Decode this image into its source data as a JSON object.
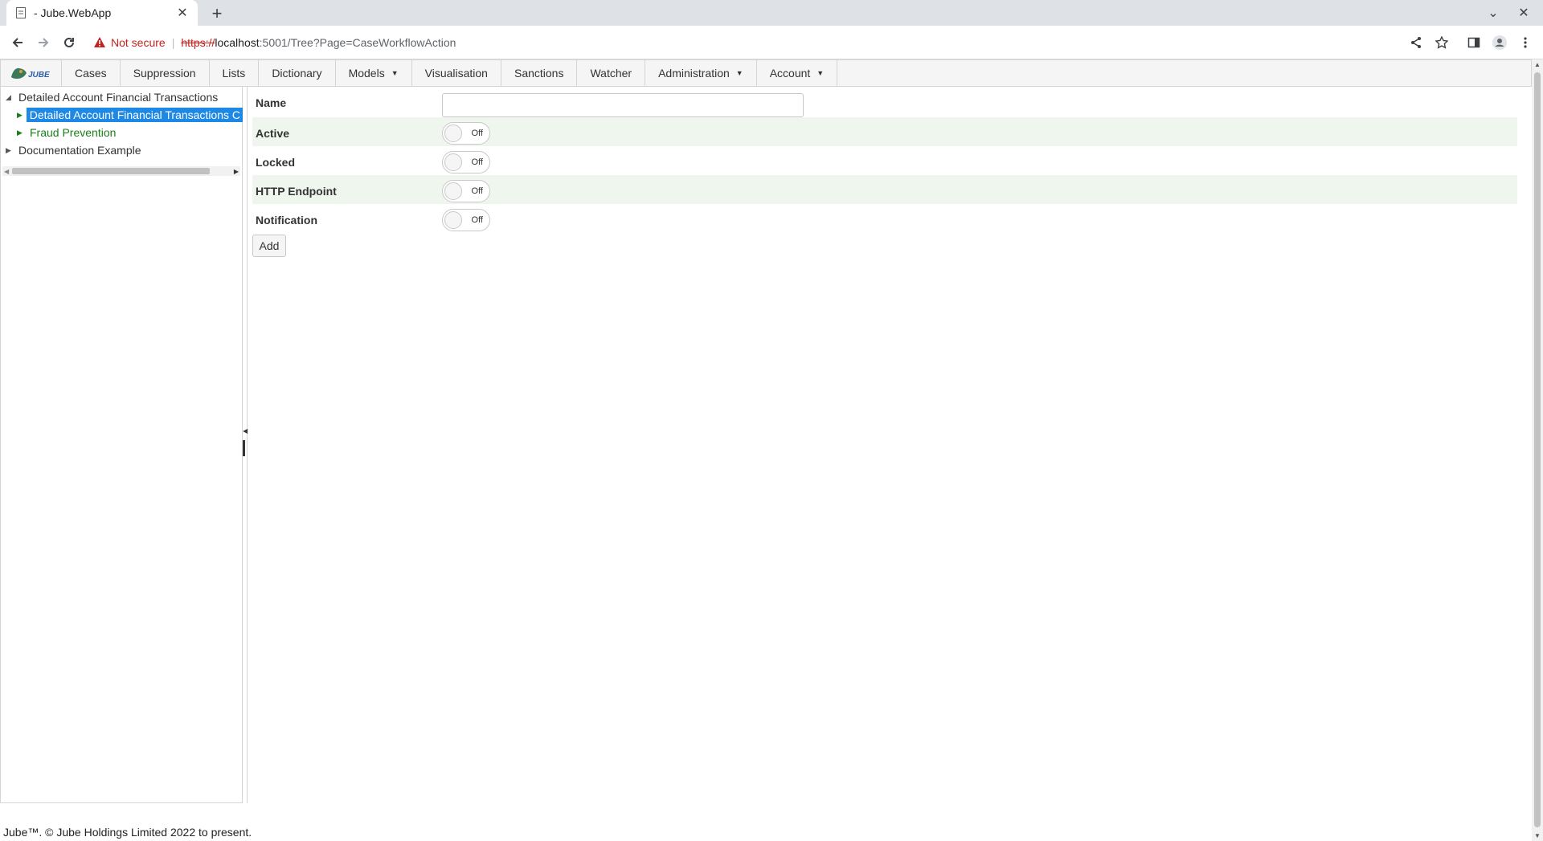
{
  "browser": {
    "tab_title": "- Jube.WebApp",
    "new_tab_glyph": "+",
    "close_glyph": "✕",
    "minimize_glyph": "⌄",
    "window_close_glyph": "✕",
    "not_secure": "Not secure",
    "url_scheme": "https://",
    "url_host": "localhost",
    "url_path": ":5001/Tree?Page=CaseWorkflowAction"
  },
  "app": {
    "logo_text": "JUBE",
    "menu": [
      {
        "label": "Cases"
      },
      {
        "label": "Suppression"
      },
      {
        "label": "Lists"
      },
      {
        "label": "Dictionary"
      },
      {
        "label": "Models",
        "dropdown": true
      },
      {
        "label": "Visualisation"
      },
      {
        "label": "Sanctions"
      },
      {
        "label": "Watcher"
      },
      {
        "label": "Administration",
        "dropdown": true
      },
      {
        "label": "Account",
        "dropdown": true
      }
    ],
    "caret": "▼"
  },
  "tree": {
    "root": "Detailed Account Financial Transactions",
    "selected": "Detailed Account Financial Transactions C",
    "child2": "Fraud Prevention",
    "root2": "Documentation Example",
    "arrow_open": "◢",
    "arrow_closed": "▶"
  },
  "form": {
    "name_label": "Name",
    "name_value": "",
    "active_label": "Active",
    "locked_label": "Locked",
    "http_label": "HTTP Endpoint",
    "notification_label": "Notification",
    "toggle_off": "Off",
    "add_label": "Add"
  },
  "footer": "Jube™. © Jube Holdings Limited 2022 to present.",
  "colors": {
    "selected_bg": "#1e88e5",
    "tree_green": "#1a7f1a",
    "row_shade": "#eef6ee",
    "not_secure_red": "#c5221f"
  }
}
